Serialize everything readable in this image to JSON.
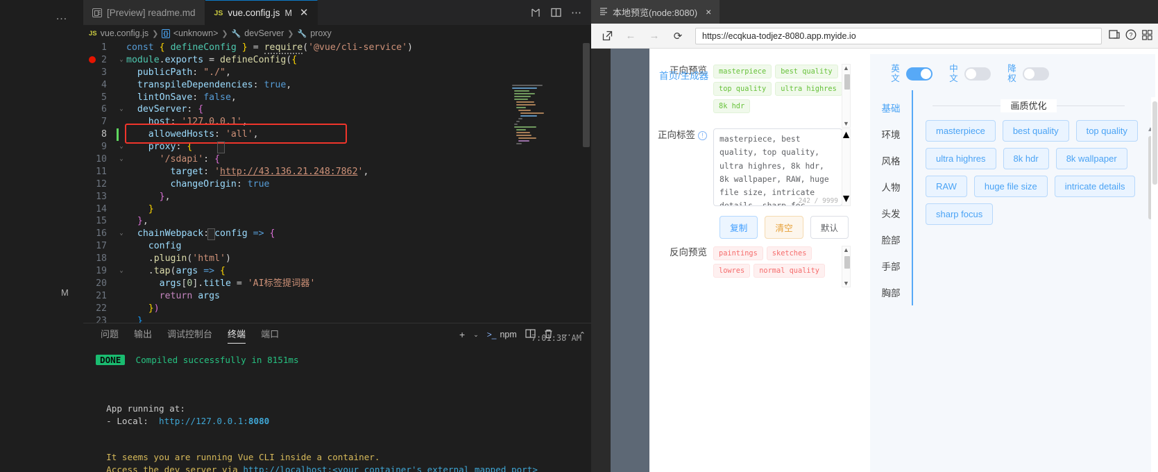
{
  "vscode": {
    "tabs": [
      {
        "icon": "preview-icon",
        "label": "[Preview] readme.md",
        "dirty": "",
        "active": false
      },
      {
        "icon": "js-icon",
        "label": "vue.config.js",
        "dirty": "M",
        "active": true
      }
    ],
    "tab_actions": [
      "split-source-control-icon",
      "split-editor-icon",
      "more-actions-icon"
    ],
    "breadcrumb": [
      "vue.config.js",
      "<unknown>",
      "devServer",
      "proxy"
    ],
    "code_lines": [
      {
        "n": "1",
        "fold": "",
        "text": "const { defineConfig } = require('@vue/cli-service')"
      },
      {
        "n": "2",
        "fold": "v",
        "text": "module.exports = defineConfig({"
      },
      {
        "n": "3",
        "fold": "",
        "text": "  publicPath: \"./\","
      },
      {
        "n": "4",
        "fold": "",
        "text": "  transpileDependencies: true,"
      },
      {
        "n": "5",
        "fold": "",
        "text": "  lintOnSave: false,"
      },
      {
        "n": "6",
        "fold": "v",
        "text": "  devServer: {"
      },
      {
        "n": "7",
        "fold": "",
        "text": "    host: '127.0.0.1',"
      },
      {
        "n": "8",
        "fold": "",
        "text": "    allowedHosts: 'all',"
      },
      {
        "n": "9",
        "fold": "v",
        "text": "    proxy: {"
      },
      {
        "n": "10",
        "fold": "v",
        "text": "      '/sdapi': {"
      },
      {
        "n": "11",
        "fold": "",
        "text": "        target: 'http://43.136.21.248:7862',"
      },
      {
        "n": "12",
        "fold": "",
        "text": "        changeOrigin: true"
      },
      {
        "n": "13",
        "fold": "",
        "text": "      },"
      },
      {
        "n": "14",
        "fold": "",
        "text": "    }"
      },
      {
        "n": "15",
        "fold": "",
        "text": "  },"
      },
      {
        "n": "16",
        "fold": "v",
        "text": "  chainWebpack: config => {"
      },
      {
        "n": "17",
        "fold": "",
        "text": "    config"
      },
      {
        "n": "18",
        "fold": "",
        "text": "    .plugin('html')"
      },
      {
        "n": "19",
        "fold": "v",
        "text": "    .tap(args => {"
      },
      {
        "n": "20",
        "fold": "",
        "text": "      args[0].title = 'AI标签提词器'"
      },
      {
        "n": "21",
        "fold": "",
        "text": "      return args"
      },
      {
        "n": "22",
        "fold": "",
        "text": "    })"
      },
      {
        "n": "23",
        "fold": "",
        "text": "  }"
      }
    ],
    "highlight_line": "8",
    "highlight_color": "#f0352b",
    "panel": {
      "tabs": [
        {
          "label": "问题",
          "active": false
        },
        {
          "label": "输出",
          "active": false
        },
        {
          "label": "调试控制台",
          "active": false
        },
        {
          "label": "终端",
          "active": true
        },
        {
          "label": "端口",
          "active": false
        }
      ],
      "actions": {
        "new_terminal": "+",
        "split_caret": "chevron-down-icon",
        "shell_label": "npm",
        "split_panel": "split-terminal-icon",
        "kill": "trash-icon",
        "more": "more-icon",
        "maximize": "chevron-up-icon"
      },
      "timestamp": "7:01:38 AM",
      "terminal": {
        "badge": "DONE",
        "compiled": "Compiled successfully in 8151ms",
        "app_running": "App running at:",
        "local_label": "- Local:",
        "local_url": "http://127.0.0.1:",
        "local_port": "8080",
        "warn1": "It seems you are running Vue CLI inside a container.",
        "warn2_a": "Access the dev server via ",
        "warn2_b": "http://localhost:<your container's external mapped port>"
      }
    },
    "activity_more": "…",
    "gutter_m": "M"
  },
  "browser": {
    "tab": {
      "icon": "page-icon",
      "label": "本地预览(node:8080)",
      "close": "×"
    },
    "nav": {
      "open_external": "open-external-icon",
      "back": "←",
      "forward": "→",
      "reload": "⟳",
      "url": "https://ecqkua-todjez-8080.app.myide.io",
      "right_icons": [
        "open-in-browser-icon",
        "help-icon",
        "grid-icon"
      ]
    },
    "app": {
      "home_link": "首页/生成器",
      "positive_preview_label": "正向预览",
      "positive_preview_chips": [
        "masterpiece",
        "best quality",
        "top quality",
        "ultra highres",
        "8k hdr"
      ],
      "positive_tags_label": "正向标签",
      "positive_tags_value": "masterpiece, best quality, top quality, ultra highres, 8k hdr, 8k wallpaper, RAW, huge file size, intricate details, sharp foc",
      "char_count": "242 / 9999",
      "buttons": {
        "copy": "复制",
        "clear": "清空",
        "default": "默认"
      },
      "negative_preview_label": "反向预览",
      "negative_preview_chips": [
        "paintings",
        "sketches",
        "lowres",
        "normal quality"
      ],
      "lang_toggles": [
        {
          "label": "英文",
          "on": true
        },
        {
          "label": "中文",
          "on": false
        },
        {
          "label": "降权",
          "on": false
        }
      ],
      "categories": [
        {
          "label": "基础",
          "active": true
        },
        {
          "label": "环境",
          "active": false
        },
        {
          "label": "风格",
          "active": false
        },
        {
          "label": "人物",
          "active": false
        },
        {
          "label": "头发",
          "active": false
        },
        {
          "label": "脸部",
          "active": false
        },
        {
          "label": "手部",
          "active": false
        },
        {
          "label": "胸部",
          "active": false
        }
      ],
      "section_title": "画质优化",
      "tag_buttons": [
        "masterpiece",
        "best quality",
        "top quality",
        "ultra highres",
        "8k hdr",
        "8k wallpaper",
        "RAW",
        "huge file size",
        "intricate details",
        "sharp focus"
      ]
    }
  },
  "colors": {
    "accent_blue": "#409eff",
    "chip_green": "#67c23a",
    "chip_red": "#f56c6c",
    "warn_orange": "#e6a23c",
    "terminal_green": "#26c281",
    "highlight_red": "#f0352b"
  }
}
